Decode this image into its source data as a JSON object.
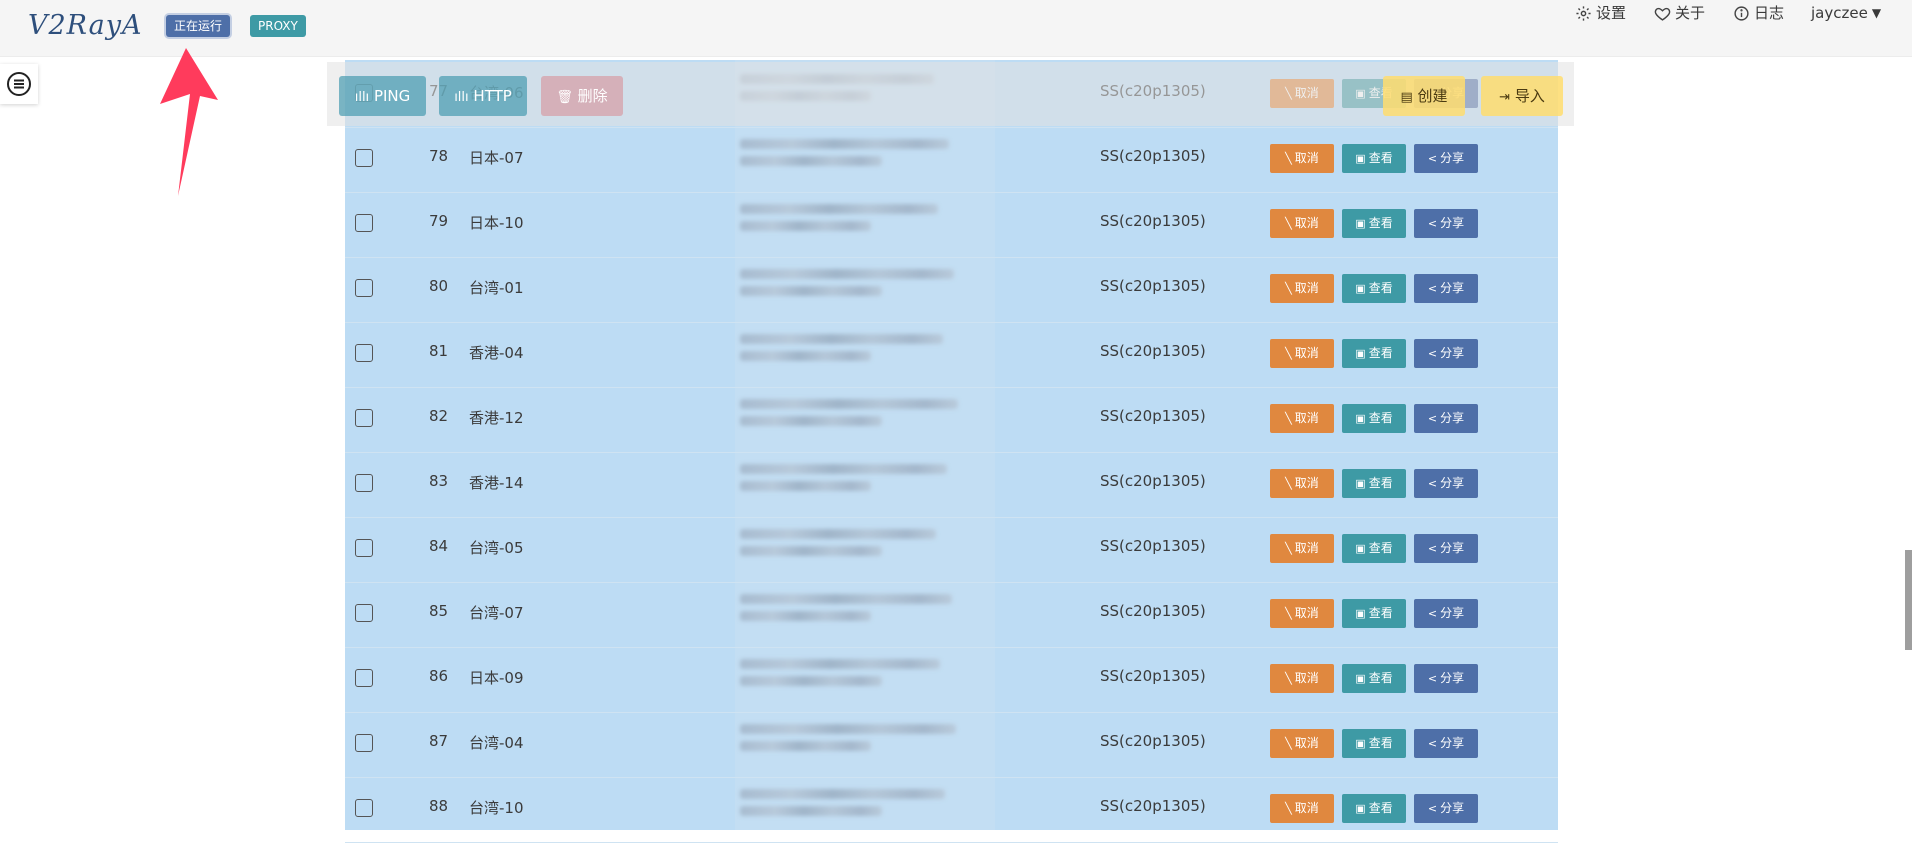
{
  "brand": {
    "logo_text": "V2RayA"
  },
  "status_tags": {
    "running": "正在运行",
    "proxy": "PROXY"
  },
  "nav": {
    "settings": "设置",
    "about": "关于",
    "log": "日志",
    "user": "jayczee"
  },
  "toolbar": {
    "ping": "PING",
    "test": "HTTP",
    "delete": "删除",
    "create": "创建",
    "import": "导入"
  },
  "row_buttons": {
    "cancel": "取消",
    "view": "查看",
    "share": "分享"
  },
  "rows": [
    {
      "index": "77",
      "name": "台湾-06",
      "protocol": "SS(c20p1305)"
    },
    {
      "index": "78",
      "name": "日本-07",
      "protocol": "SS(c20p1305)"
    },
    {
      "index": "79",
      "name": "日本-10",
      "protocol": "SS(c20p1305)"
    },
    {
      "index": "80",
      "name": "台湾-01",
      "protocol": "SS(c20p1305)"
    },
    {
      "index": "81",
      "name": "香港-04",
      "protocol": "SS(c20p1305)"
    },
    {
      "index": "82",
      "name": "香港-12",
      "protocol": "SS(c20p1305)"
    },
    {
      "index": "83",
      "name": "香港-14",
      "protocol": "SS(c20p1305)"
    },
    {
      "index": "84",
      "name": "台湾-05",
      "protocol": "SS(c20p1305)"
    },
    {
      "index": "85",
      "name": "台湾-07",
      "protocol": "SS(c20p1305)"
    },
    {
      "index": "86",
      "name": "日本-09",
      "protocol": "SS(c20p1305)"
    },
    {
      "index": "87",
      "name": "台湾-04",
      "protocol": "SS(c20p1305)"
    },
    {
      "index": "88",
      "name": "台湾-10",
      "protocol": "SS(c20p1305)"
    }
  ],
  "colors": {
    "selected_row_bg": "#bddcf4",
    "cancel_button": "#e0883f",
    "view_button": "#3e9aa5",
    "share_button": "#4e6fa8",
    "running_tag": "#4e6fa8",
    "proxy_tag": "#3e9aa5",
    "annotation_arrow": "#ff3b5c"
  }
}
